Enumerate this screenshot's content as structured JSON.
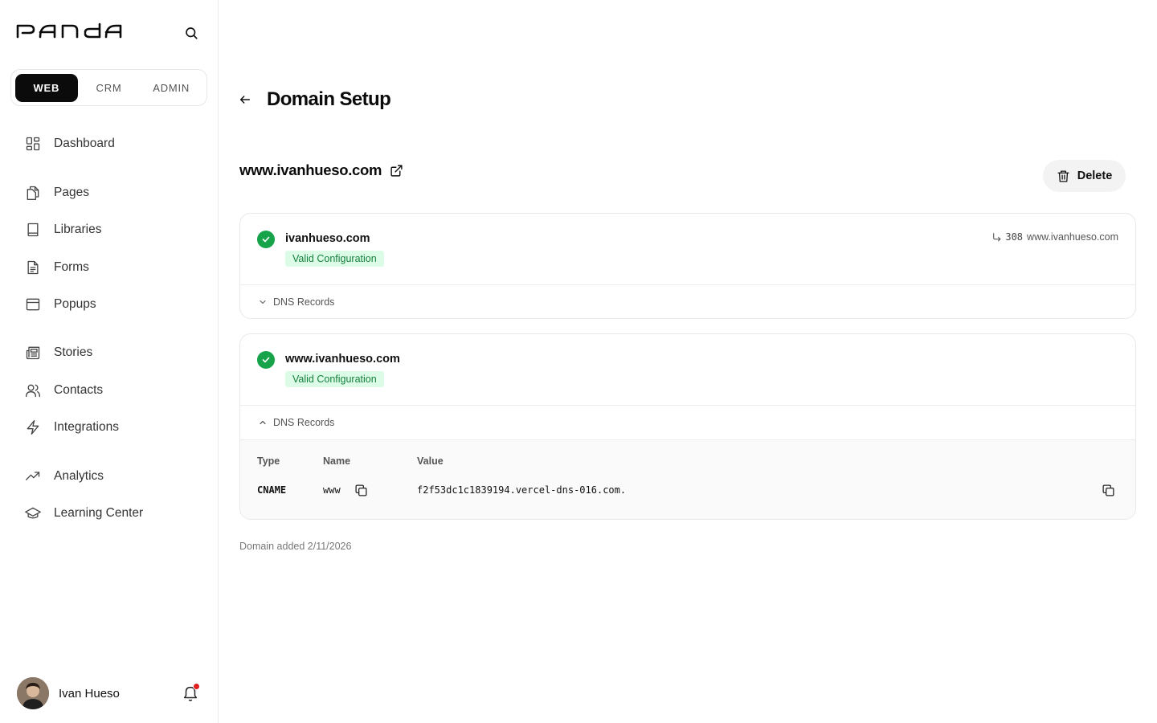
{
  "sidebar": {
    "logo_text": "PANDA",
    "segments": [
      {
        "label": "WEB",
        "active": true
      },
      {
        "label": "CRM",
        "active": false
      },
      {
        "label": "ADMIN",
        "active": false
      }
    ],
    "nav": [
      {
        "label": "Dashboard",
        "icon": "dashboard-icon"
      },
      {
        "label": "Pages",
        "icon": "pages-icon"
      },
      {
        "label": "Libraries",
        "icon": "book-icon"
      },
      {
        "label": "Forms",
        "icon": "document-icon"
      },
      {
        "label": "Popups",
        "icon": "window-icon"
      },
      {
        "label": "Stories",
        "icon": "newspaper-icon"
      },
      {
        "label": "Contacts",
        "icon": "users-icon"
      },
      {
        "label": "Integrations",
        "icon": "bolt-icon"
      },
      {
        "label": "Analytics",
        "icon": "trending-up-icon"
      },
      {
        "label": "Learning Center",
        "icon": "graduation-cap-icon"
      }
    ],
    "user": {
      "name": "Ivan Hueso",
      "has_notification": true
    }
  },
  "header": {
    "title": "Domain Setup"
  },
  "domain": {
    "name": "www.ivanhueso.com",
    "delete_label": "Delete"
  },
  "cards": [
    {
      "domain": "ivanhueso.com",
      "status": "Valid Configuration",
      "redirect_code": "308",
      "redirect_target": "www.ivanhueso.com",
      "dns_label": "DNS Records",
      "expanded": false
    },
    {
      "domain": "www.ivanhueso.com",
      "status": "Valid Configuration",
      "dns_label": "DNS Records",
      "expanded": true,
      "table": {
        "headers": {
          "type": "Type",
          "name": "Name",
          "value": "Value"
        },
        "rows": [
          {
            "type": "CNAME",
            "name": "www",
            "value": "f2f53dc1c1839194.vercel-dns-016.com."
          }
        ]
      }
    }
  ],
  "footer": {
    "added_text": "Domain added 2/11/2026"
  },
  "colors": {
    "accent": "#0b0b0b",
    "success": "#16a34a",
    "success_bg": "#dcfce7",
    "notification": "#e21d1d"
  }
}
